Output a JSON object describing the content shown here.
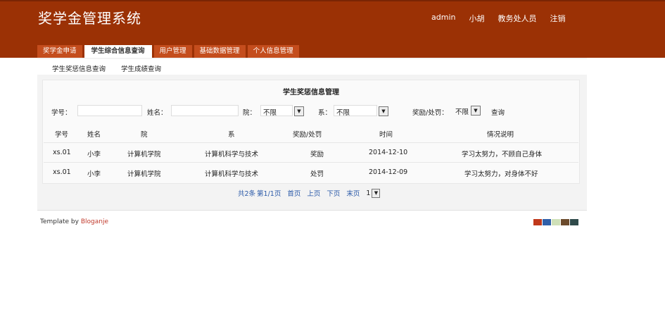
{
  "header": {
    "title": "奖学金管理系统",
    "user_nav": [
      "admin",
      "小胡",
      "教务处人员",
      "注销"
    ]
  },
  "tabs": [
    "奖学金申请",
    "学生综合信息查询",
    "用户管理",
    "基础数据管理",
    "个人信息管理"
  ],
  "active_tab": 1,
  "subnav": [
    "学生奖惩信息查询",
    "学生成绩查询"
  ],
  "section_title": "学生奖惩信息管理",
  "filters": {
    "student_id_label": "学号：",
    "student_id_value": "",
    "name_label": "姓名：",
    "name_value": "",
    "college_label": "院：",
    "college_value": "不限",
    "dept_label": "系：",
    "dept_value": "不限",
    "reward_label": "奖励/处罚：",
    "reward_value": "不限",
    "search_label": "查询"
  },
  "table": {
    "headers": [
      "学号",
      "姓名",
      "院",
      "系",
      "奖励/处罚",
      "时间",
      "情况说明"
    ],
    "rows": [
      [
        "xs.01",
        "小李",
        "计算机学院",
        "计算机科学与技术",
        "奖励",
        "2014-12-10",
        "学习太努力，不顾自己身体"
      ],
      [
        "xs.01",
        "小李",
        "计算机学院",
        "计算机科学与技术",
        "处罚",
        "2014-12-09",
        "学习太努力，对身体不好"
      ]
    ]
  },
  "pagination": {
    "total": "共2条",
    "page_info": "第1/1页",
    "first": "首页",
    "prev": "上页",
    "next": "下页",
    "last": "末页",
    "page_select": "1"
  },
  "footer": {
    "prefix": "Template by",
    "brand": "Bloganje"
  },
  "colors": {
    "header_bg": "#9b3105",
    "tab_bg": "#c44d1d",
    "link": "#2a59a8",
    "swatches": [
      "#c0391b",
      "#2f5fa8",
      "#cfe0b8",
      "#6b4a2c",
      "#2f4a4a"
    ]
  }
}
